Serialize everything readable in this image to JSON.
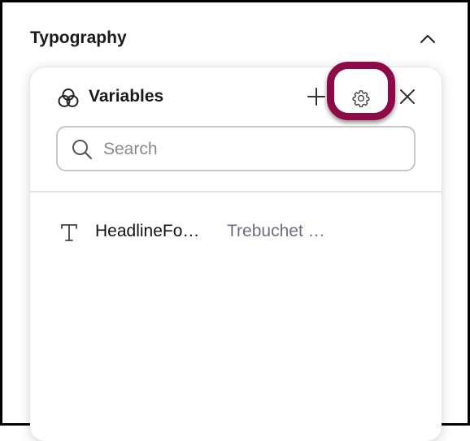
{
  "section": {
    "title": "Typography",
    "collapse_icon": "chevron-up-icon"
  },
  "panel": {
    "title": "Variables",
    "title_icon": "variables-circles-icon",
    "add_icon": "plus-icon",
    "settings_icon": "gear-icon",
    "close_icon": "close-icon",
    "highlight_color": "#8c0a45"
  },
  "search": {
    "placeholder": "Search",
    "value": "",
    "icon": "search-icon"
  },
  "variables": [
    {
      "type_icon": "text-type-icon",
      "name": "HeadlineFo…",
      "value": "Trebuchet …"
    }
  ]
}
